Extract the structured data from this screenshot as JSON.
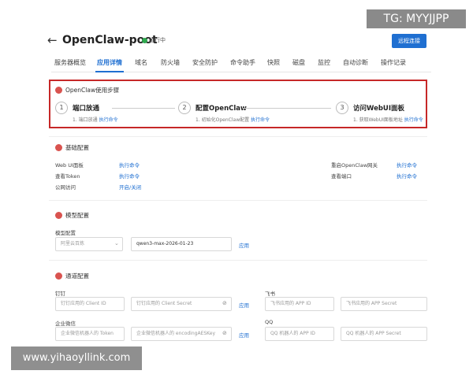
{
  "watermark_tag": "TG: MYYJJPP",
  "watermark_url": "www.yihaoyllink.com",
  "header": {
    "back": "←",
    "title": "OpenClaw-poot",
    "status": "运行中",
    "connect_button": "远程连接"
  },
  "tabs": [
    {
      "label": "服务器概览"
    },
    {
      "label": "应用详情"
    },
    {
      "label": "域名"
    },
    {
      "label": "防火墙"
    },
    {
      "label": "安全防护"
    },
    {
      "label": "命令助手"
    },
    {
      "label": "快照"
    },
    {
      "label": "磁盘"
    },
    {
      "label": "监控"
    },
    {
      "label": "自动诊断"
    },
    {
      "label": "操作记录"
    }
  ],
  "steps": {
    "title": "OpenClaw使用步骤",
    "items": [
      {
        "num": "1",
        "title": "端口放通",
        "desc": "1. 端口放通",
        "action": "执行命令"
      },
      {
        "num": "2",
        "title": "配置OpenClaw",
        "desc": "1. 初始化OpenClaw配置",
        "action": "执行命令"
      },
      {
        "num": "3",
        "title": "访问WebUI面板",
        "desc": "1. 获取WebUI面板地址",
        "action": "执行命令"
      }
    ]
  },
  "basic": {
    "title": "基础配置",
    "rows": [
      {
        "label": "Web UI面板",
        "action": "执行命令"
      },
      {
        "label": "查看Token",
        "action": "执行命令"
      },
      {
        "label": "公网访问",
        "action": "开启/关闭"
      }
    ],
    "right_rows": [
      {
        "label": "重启OpenClaw网关",
        "action": "执行命令"
      },
      {
        "label": "查看端口",
        "action": "执行命令"
      }
    ]
  },
  "model": {
    "title": "模型配置",
    "field_label": "模型配置",
    "provider_placeholder": "阿里云百炼",
    "model_value": "qwen3-max-2026-01-23",
    "apply": "应用"
  },
  "channel": {
    "title": "通道配置",
    "dingtalk_label": "钉钉",
    "dingtalk_id_placeholder": "钉钉应用的 Client ID",
    "dingtalk_secret_placeholder": "钉钉应用的 Client Secret",
    "dingtalk_apply": "应用",
    "feishu_label": "飞书",
    "feishu_id_placeholder": "飞书应用的 APP ID",
    "feishu_secret_placeholder": "飞书应用的 APP Secret",
    "wecom_label": "企业微信",
    "wecom_token_placeholder": "企业微信机器人的 Token",
    "wecom_aes_placeholder": "企业微信机器人的 encodingAESKey",
    "wecom_apply": "应用",
    "qq_label": "QQ",
    "qq_id_placeholder": "QQ 机器人的 APP ID",
    "qq_secret_placeholder": "QQ 机器人的 APP Secret"
  },
  "colors": {
    "accent": "#1f6fd1",
    "highlight_border": "#c62828",
    "status_running": "#2fa84f"
  }
}
